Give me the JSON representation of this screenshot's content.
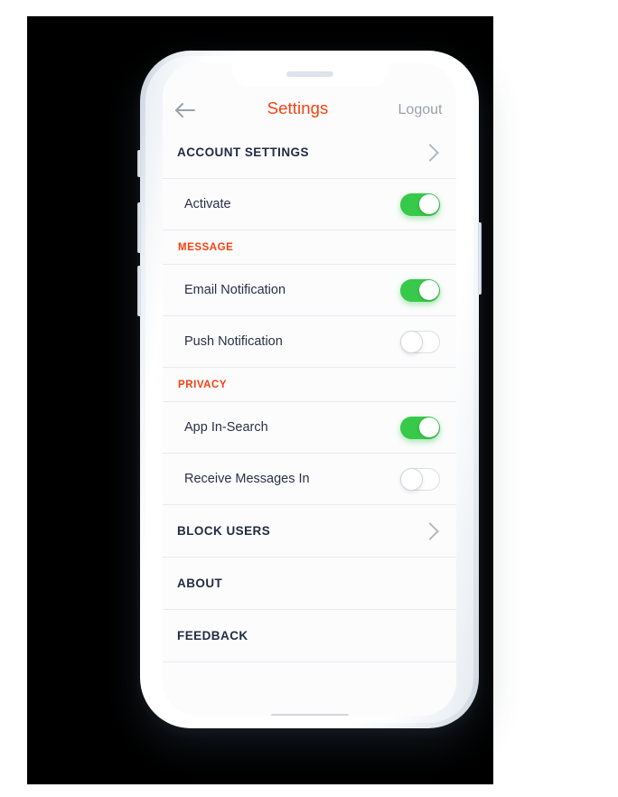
{
  "backdrop": {
    "color": "#000000"
  },
  "device": {
    "buttons": [
      {
        "name": "silent-switch"
      },
      {
        "name": "volume-up-button"
      },
      {
        "name": "volume-down-button"
      },
      {
        "name": "power-button"
      }
    ]
  },
  "header": {
    "back_icon": "arrow-left-icon",
    "title": "Settings",
    "title_color": "#f9400f",
    "logout_label": "Logout",
    "logout_color": "#9aa1a9"
  },
  "colors": {
    "accent": "#f9400f",
    "toggle_on": "#36c94a",
    "toggle_off_border": "#dcdfe3",
    "text_primary": "#232c44",
    "divider": "#e9eaee",
    "row_bg": "#fcfcfd"
  },
  "list": [
    {
      "type": "nav",
      "name": "account-settings",
      "label": "ACCOUNT SETTINGS",
      "chevron": true
    },
    {
      "type": "toggle",
      "name": "activate",
      "label": "Activate",
      "state": "on"
    },
    {
      "type": "section",
      "name": "message",
      "label": "MESSAGE"
    },
    {
      "type": "toggle",
      "name": "email-notification",
      "label": "Email Notification",
      "state": "on"
    },
    {
      "type": "toggle",
      "name": "push-notification",
      "label": "Push Notification",
      "state": "off"
    },
    {
      "type": "section",
      "name": "privacy",
      "label": "PRIVACY"
    },
    {
      "type": "toggle",
      "name": "app-in-search",
      "label": "App In-Search",
      "state": "on"
    },
    {
      "type": "toggle",
      "name": "receive-messages-in",
      "label": "Receive Messages In",
      "state": "off"
    },
    {
      "type": "nav",
      "name": "block-users",
      "label": "BLOCK USERS",
      "chevron": true
    },
    {
      "type": "nav",
      "name": "about",
      "label": "ABOUT",
      "chevron": false
    },
    {
      "type": "nav",
      "name": "feedback",
      "label": "FEEDBACK",
      "chevron": false
    }
  ]
}
